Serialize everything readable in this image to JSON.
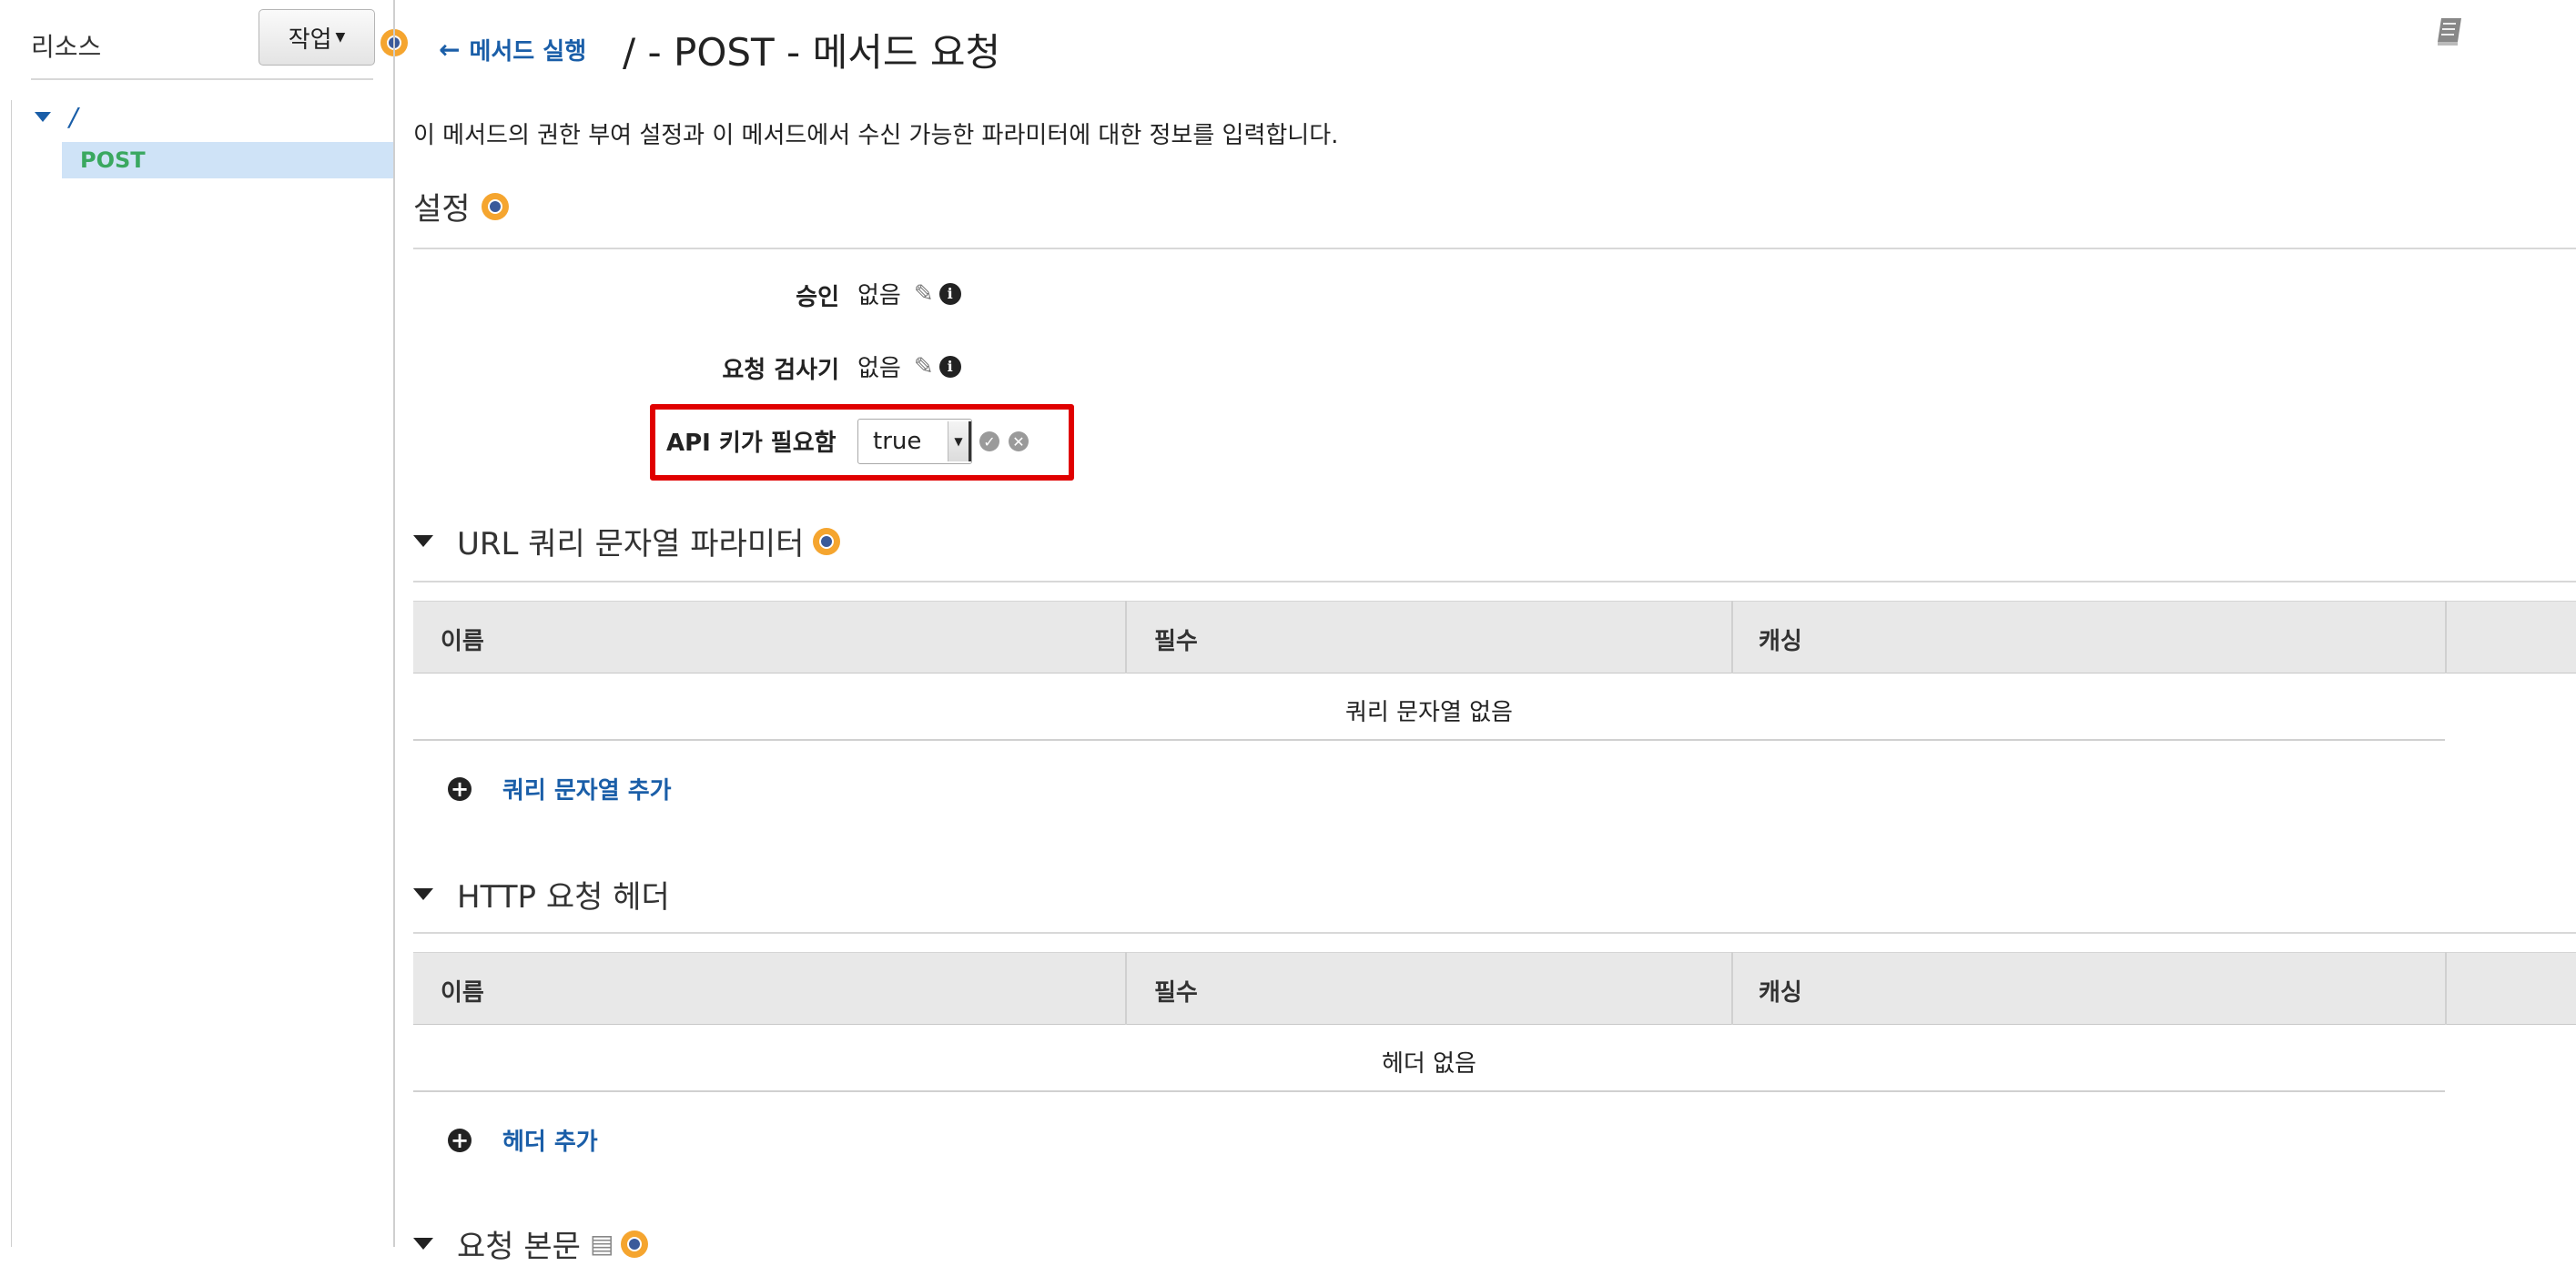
{
  "sidebar": {
    "title": "리소스",
    "action_label": "작업",
    "tree": [
      {
        "label": "/"
      },
      {
        "label": "POST"
      }
    ]
  },
  "header": {
    "back_label": "메서드 실행",
    "title": "/ - POST - 메서드 요청"
  },
  "description": "이 메서드의 권한 부여 설정과 이 메서드에서 수신 가능한 파라미터에 대한 정보를 입력합니다.",
  "settings": {
    "title": "설정",
    "rows": [
      {
        "label": "승인",
        "value": "없음"
      },
      {
        "label": "요청 검사기",
        "value": "없음"
      },
      {
        "label": "API 키가 필요함",
        "value": "true"
      }
    ]
  },
  "query_params": {
    "title": "URL 쿼리 문자열 파라미터",
    "columns": [
      "이름",
      "필수",
      "캐싱"
    ],
    "empty_text": "쿼리 문자열 없음",
    "add_label": "쿼리 문자열 추가"
  },
  "http_headers": {
    "title": "HTTP 요청 헤더",
    "columns": [
      "이름",
      "필수",
      "캐싱"
    ],
    "empty_text": "헤더 없음",
    "add_label": "헤더 추가"
  },
  "request_body": {
    "title": "요청 본문"
  },
  "colors": {
    "link": "#1a5ea8",
    "highlight_border": "#e00000",
    "selected_bg": "#cfe3f7",
    "method_green": "#3aa860",
    "info_orange": "#f5a52f"
  }
}
